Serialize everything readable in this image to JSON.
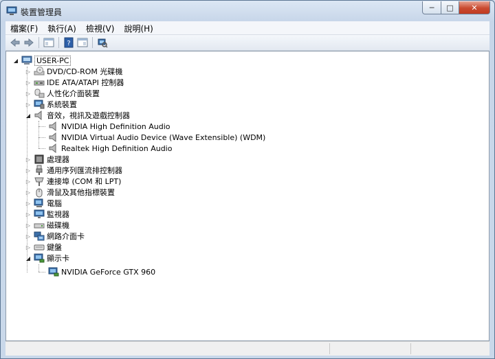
{
  "window": {
    "title": "裝置管理員",
    "buttons": {
      "minimize": "─",
      "maximize": "□",
      "close": "✕"
    }
  },
  "menu": [
    "檔案(F)",
    "執行(A)",
    "檢視(V)",
    "說明(H)"
  ],
  "toolbar": [
    "back-icon",
    "forward-icon",
    "console-tree-icon",
    "help-icon",
    "properties-icon",
    "scan-hardware-icon"
  ],
  "tree": {
    "root": "USER-PC",
    "items": [
      {
        "label": "DVD/CD-ROM 光碟機",
        "icon": "dvd-drive-icon",
        "expanded": false
      },
      {
        "label": "IDE ATA/ATAPI 控制器",
        "icon": "ide-controller-icon",
        "expanded": false
      },
      {
        "label": "人性化介面裝置",
        "icon": "hid-icon",
        "expanded": false
      },
      {
        "label": "系統裝置",
        "icon": "system-device-icon",
        "expanded": false
      },
      {
        "label": "音效，視訊及遊戲控制器",
        "icon": "speaker-icon",
        "expanded": true,
        "children": [
          {
            "label": "NVIDIA High Definition Audio",
            "icon": "speaker-icon"
          },
          {
            "label": "NVIDIA Virtual Audio Device (Wave Extensible) (WDM)",
            "icon": "speaker-icon"
          },
          {
            "label": "Realtek High Definition Audio",
            "icon": "speaker-icon"
          }
        ]
      },
      {
        "label": "處理器",
        "icon": "processor-icon",
        "expanded": false
      },
      {
        "label": "通用序列匯流排控制器",
        "icon": "usb-icon",
        "expanded": false
      },
      {
        "label": "連接埠 (COM 和 LPT)",
        "icon": "port-icon",
        "expanded": false
      },
      {
        "label": "滑鼠及其他指標裝置",
        "icon": "mouse-icon",
        "expanded": false
      },
      {
        "label": "電腦",
        "icon": "computer-icon",
        "expanded": false
      },
      {
        "label": "監視器",
        "icon": "monitor-icon",
        "expanded": false
      },
      {
        "label": "磁碟機",
        "icon": "disk-drive-icon",
        "expanded": false
      },
      {
        "label": "網路介面卡",
        "icon": "network-adapter-icon",
        "expanded": false
      },
      {
        "label": "鍵盤",
        "icon": "keyboard-icon",
        "expanded": false
      },
      {
        "label": "顯示卡",
        "icon": "display-adapter-icon",
        "expanded": true,
        "children": [
          {
            "label": "NVIDIA GeForce GTX 960",
            "icon": "display-adapter-icon"
          }
        ]
      }
    ]
  }
}
